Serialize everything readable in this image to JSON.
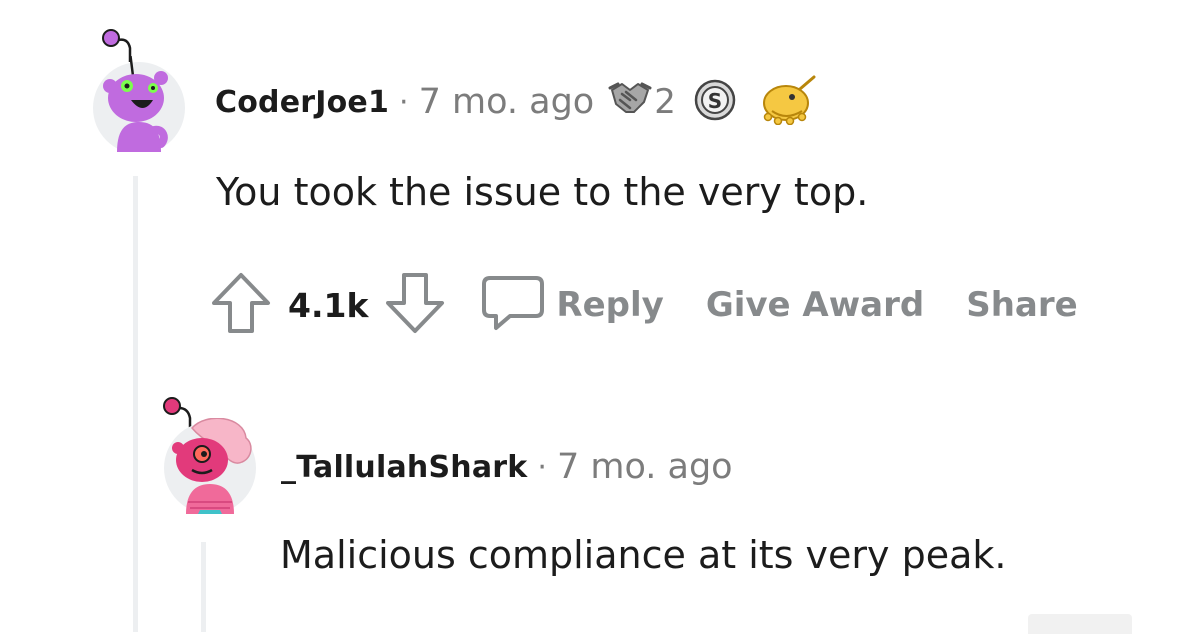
{
  "comments": [
    {
      "username": "CoderJoe1",
      "separator": "·",
      "timestamp": "7 mo. ago",
      "awards": [
        {
          "icon": "handshake-award-icon",
          "count": "2"
        },
        {
          "icon": "silver-award-icon",
          "count": ""
        },
        {
          "icon": "narwhal-award-icon",
          "count": ""
        }
      ],
      "body": "You took the issue to the very top.",
      "avatar": {
        "icon": "snoo-avatar-purple",
        "color": "#c06bdf"
      },
      "votes": "4.1k",
      "actions": {
        "reply": "Reply",
        "give_award": "Give Award",
        "share": "Share"
      }
    },
    {
      "username": "_TallulahShark",
      "separator": "·",
      "timestamp": "7 mo. ago",
      "body": "Malicious compliance at its very peak.",
      "avatar": {
        "icon": "snoo-avatar-pink",
        "color": "#e23a7b"
      }
    }
  ],
  "colors": {
    "text_primary": "#1c1c1c",
    "text_meta": "#7c7c7c",
    "action_gray": "#878a8c",
    "thread_line": "#edeff1"
  }
}
